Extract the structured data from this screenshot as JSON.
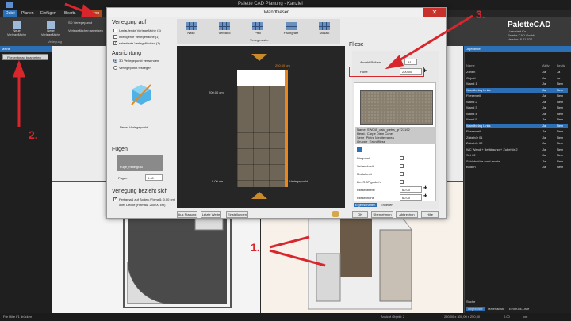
{
  "app": {
    "title": "Palette CAD Planung - Kanzlei",
    "ribbon_tabs": [
      "Datei",
      "Planen",
      "Einfügen",
      "Bearb.",
      "Fliesen"
    ],
    "ribbon_buttons": [
      "Neue Verlegefläche",
      "Neue Verlegefläche",
      "SD Verlegepunkt",
      "Verlegeflächen anzeigen"
    ],
    "ribbon_group": "Verlegung",
    "brand": {
      "logo": "PaletteCAD",
      "license_label": "Lizenziert für",
      "license_to": "Palette CAD GmbH",
      "version": "Version: 8.21.527"
    }
  },
  "left_panel": {
    "header": "Meine",
    "item": "Fliesenbelag bearbeiten"
  },
  "right_panel": {
    "header": "Objektliste",
    "columns": [
      "Name",
      "Aktiv",
      "Besitz"
    ],
    "rows": [
      {
        "name": "Zonen",
        "a": "Ja",
        "b": "Ja"
      },
      {
        "name": "Objekt",
        "a": "Ja",
        "b": "Ja"
      },
      {
        "name": "Wand 1",
        "a": "Ja",
        "b": "Nein"
      },
      {
        "name": "Wandbelag Links",
        "a": "Ja",
        "b": "Nein"
      },
      {
        "name": "Fliesenteil",
        "a": "Ja",
        "b": "Nein"
      },
      {
        "name": "Wand 2",
        "a": "Ja",
        "b": "Nein"
      },
      {
        "name": "Wand 3",
        "a": "Ja",
        "b": "Nein"
      },
      {
        "name": "Wand 4",
        "a": "Ja",
        "b": "Nein"
      },
      {
        "name": "Wand 5",
        "a": "Ja",
        "b": "Nein"
      },
      {
        "name": "Wandbelag Links",
        "a": "Ja",
        "b": "Nein"
      },
      {
        "name": "Fliesenteil",
        "a": "Ja",
        "b": "Nein"
      },
      {
        "name": "Zubehör 01",
        "a": "Ja",
        "b": "Nein"
      },
      {
        "name": "Zubehör 02",
        "a": "Ja",
        "b": "Nein"
      },
      {
        "name": "WC Wand + Betätigung + Zubehör 2",
        "a": "Ja",
        "b": "Nein"
      },
      {
        "name": "Set 02",
        "a": "Ja",
        "b": "Nein"
      },
      {
        "name": "Schiebetüre rund rechts",
        "a": "Ja",
        "b": "Nein"
      },
      {
        "name": "Boden",
        "a": "Ja",
        "b": "Nein"
      }
    ],
    "search_label": "Suche",
    "bottom_tabs": [
      "Objektliste",
      "Materialliste",
      "Eindruck-Liste"
    ]
  },
  "status": {
    "left": "Für Hilfe F1 drücken",
    "center": "Ansicht Objekt: 2",
    "coords": "250,00 x 300,00 x 250,00",
    "zoom": "0.00",
    "unit": "cm"
  },
  "dialog": {
    "title": "Wandfliesen",
    "close": "✕",
    "verlegung": {
      "title": "Verlegung auf",
      "options": [
        {
          "label": "Umlaufende Verlegefläche (3)",
          "checked": false
        },
        {
          "label": "Intelligente Verlegefläche (1)",
          "checked": false
        },
        {
          "label": "selektierte Verlegeflächen (1)",
          "checked": true
        }
      ]
    },
    "ausrichtung": {
      "title": "Ausrichtung",
      "options": [
        {
          "label": "3D Verlegepunkt verwenden",
          "on": true
        },
        {
          "label": "Verlegepunkt festlegen",
          "on": false
        }
      ],
      "setpoint": "Neuer Verlegepunkt"
    },
    "fugen": {
      "title": "Fugen",
      "material": "Fuge_mittelgrau",
      "label": "Fugen",
      "value": "0.40"
    },
    "bezieht": {
      "title": "Verlegung bezieht sich",
      "options": [
        {
          "label": "Fertigmaß auf Boden (Fixmaß: 0.00 cm)",
          "checked": true
        },
        {
          "label": "oder Decke (Fixmaß: 250.00 cm)",
          "checked": false
        }
      ]
    },
    "patterns": [
      {
        "label": "Nase",
        "ico": "grid"
      },
      {
        "label": "Verband",
        "ico": "brick"
      },
      {
        "label": "Pfeil",
        "ico": "arrow"
      },
      {
        "label": "Fischgräte",
        "ico": "herring"
      },
      {
        "label": "Mosaik",
        "ico": "mosaic"
      }
    ],
    "pattern_bar_label": "Verlegeraster",
    "preview": {
      "height_top": "250,00 cm",
      "height_mid": "200.00 cm",
      "height_bottom": "0.00 cm",
      "anchor": "Verlegepunkt"
    },
    "fliese": {
      "title": "Fliese",
      "anzahl_label": "Anzahl Reihen",
      "anzahl_value": "-41",
      "hoehe_label": "Höhe",
      "hoehe_value": "200.00",
      "info": {
        "name_l": "Name",
        "name": "SW045_calc_pietra_gr727192",
        "hersteller_l": "Herst.",
        "hersteller": "Carpe Diem Cone",
        "serie_l": "Serie",
        "serie": "Pietra Mediterranea",
        "gruppe_l": "Gruppe",
        "gruppe": "Grundfliese"
      },
      "options": [
        {
          "label": "Diagonal",
          "checked": false
        },
        {
          "label": "Schachbrett",
          "checked": false
        },
        {
          "label": "Modulbreit",
          "checked": false
        },
        {
          "label": "Lin. RGP gedreht",
          "checked": false
        }
      ],
      "breite_label": "Fliesenbreite",
      "breite_value": "60.00",
      "hoehe2_label": "Fliesenhöhe",
      "hoehe2_value": "60.00",
      "tabs": [
        "Eigenschaften",
        "Erweitert"
      ]
    },
    "footer_left": [
      "Aus Planung",
      "Letzte Werte",
      "Einstellungen"
    ],
    "footer_right": [
      "OK",
      "Übernehmen",
      "Abbrechen",
      "Hilfe"
    ]
  },
  "annotations": {
    "c1": "1.",
    "c2": "2.",
    "c3": "3."
  }
}
